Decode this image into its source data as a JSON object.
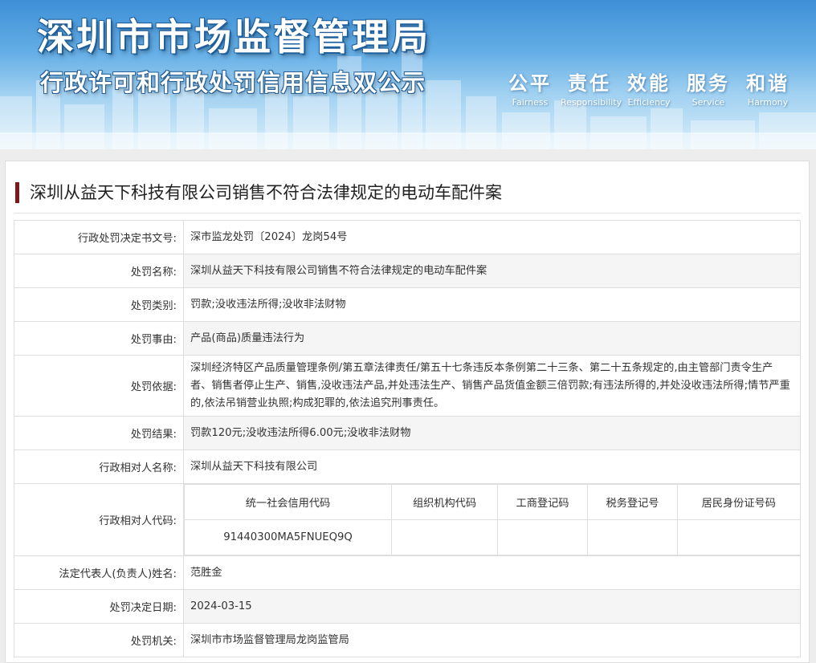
{
  "banner": {
    "title_main": "深圳市市场监督管理局",
    "title_sub": "行政许可和行政处罚信用信息双公示",
    "motto": [
      {
        "cn": "公平",
        "en": "Fairness"
      },
      {
        "cn": "责任",
        "en": "Responsibility"
      },
      {
        "cn": "效能",
        "en": "Efficiency"
      },
      {
        "cn": "服务",
        "en": "Service"
      },
      {
        "cn": "和谐",
        "en": "Harmony"
      }
    ]
  },
  "case": {
    "title": "深圳从益天下科技有限公司销售不符合法律规定的电动车配件案"
  },
  "rows": {
    "doc_no": {
      "label": "行政处罚决定书文号:",
      "value": "深市监龙处罚〔2024〕龙岗54号"
    },
    "name": {
      "label": "处罚名称:",
      "value": "深圳从益天下科技有限公司销售不符合法律规定的电动车配件案"
    },
    "type": {
      "label": "处罚类别:",
      "value": "罚款;没收违法所得;没收非法财物"
    },
    "reason": {
      "label": "处罚事由:",
      "value": "产品(商品)质量违法行为"
    },
    "basis": {
      "label": "处罚依据:",
      "value": "深圳经济特区产品质量管理条例/第五章法律责任/第五十七条违反本条例第二十三条、第二十五条规定的,由主管部门责令生产者、销售者停止生产、销售,没收违法产品,并处违法生产、销售产品货值金额三倍罚款;有违法所得的,并处没收违法所得;情节严重的,依法吊销营业执照;构成犯罪的,依法追究刑事责任。"
    },
    "result": {
      "label": "处罚结果:",
      "value": "罚款120元;没收违法所得6.00元;没收非法财物"
    },
    "party_name": {
      "label": "行政相对人名称:",
      "value": "深圳从益天下科技有限公司"
    },
    "party_code": {
      "label": "行政相对人代码:",
      "headers": [
        "统一社会信用代码",
        "组织机构代码",
        "工商登记码",
        "税务登记号",
        "居民身份证号码"
      ],
      "values": [
        "91440300MA5FNUEQ9Q",
        "",
        "",
        "",
        ""
      ]
    },
    "legal_rep": {
      "label": "法定代表人(负责人)姓名:",
      "value": "范胜金"
    },
    "date": {
      "label": "处罚决定日期:",
      "value": "2024-03-15"
    },
    "authority": {
      "label": "处罚机关:",
      "value": "深圳市市场监督管理局龙岗监管局"
    }
  },
  "colors": {
    "accent_bar": "#7b1818",
    "banner_blue": "#3d8fd6"
  }
}
